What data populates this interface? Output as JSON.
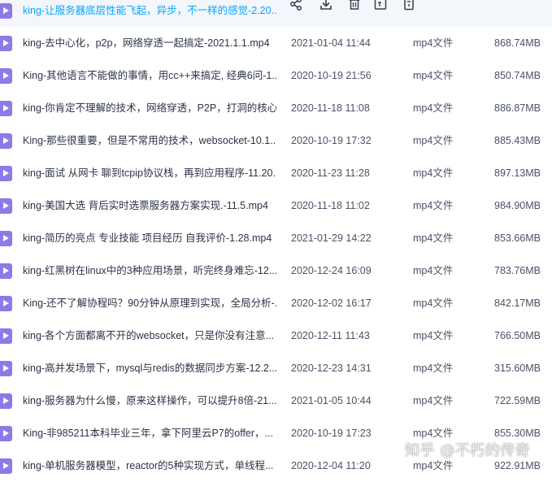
{
  "files": [
    {
      "name": "king-让服务器底层性能飞起，异步，不一样的感觉-2.20...",
      "date": "",
      "type": "",
      "size": "",
      "hovered": true
    },
    {
      "name": "king-去中心化，p2p，网络穿透一起搞定-2021.1.1.mp4",
      "date": "2021-01-04 11:44",
      "type": "mp4文件",
      "size": "868.74MB"
    },
    {
      "name": "King-其他语言不能做的事情，用cc++来搞定, 经典6问-1...",
      "date": "2020-10-19 21:56",
      "type": "mp4文件",
      "size": "850.74MB"
    },
    {
      "name": "king-你肯定不理解的技术，网络穿透，P2P，打洞的核心...",
      "date": "2020-11-18 11:08",
      "type": "mp4文件",
      "size": "886.87MB"
    },
    {
      "name": "King-那些很重要，但是不常用的技术，websocket-10.1...",
      "date": "2020-10-19 17:32",
      "type": "mp4文件",
      "size": "885.43MB"
    },
    {
      "name": "king-面试 从网卡 聊到tcpip协议栈，再到应用程序-11.20...",
      "date": "2020-11-23 11:28",
      "type": "mp4文件",
      "size": "897.13MB"
    },
    {
      "name": "king-美国大选 背后实时选票服务器方案实现.-11.5.mp4",
      "date": "2020-11-18 11:02",
      "type": "mp4文件",
      "size": "984.90MB"
    },
    {
      "name": "king-简历的亮点 专业技能 项目经历 自我评价-1.28.mp4",
      "date": "2021-01-29 14:22",
      "type": "mp4文件",
      "size": "853.66MB"
    },
    {
      "name": "king-红黑树在linux中的3种应用场景，听完终身难忘-12....",
      "date": "2020-12-24 16:09",
      "type": "mp4文件",
      "size": "783.76MB"
    },
    {
      "name": "King-还不了解协程吗？90分钟从原理到实现，全局分析-...",
      "date": "2020-12-02 16:17",
      "type": "mp4文件",
      "size": "842.17MB"
    },
    {
      "name": "king-各个方面都离不开的websocket，只是你没有注意...",
      "date": "2020-12-11 11:43",
      "type": "mp4文件",
      "size": "766.50MB"
    },
    {
      "name": "king-高并发场景下，mysql与redis的数据同步方案-12.2...",
      "date": "2020-12-23 14:31",
      "type": "mp4文件",
      "size": "315.60MB"
    },
    {
      "name": "king-服务器为什么慢，原来这样操作，可以提升8倍-21....",
      "date": "2021-01-05 10:44",
      "type": "mp4文件",
      "size": "722.59MB"
    },
    {
      "name": "King-非985211本科毕业三年，拿下阿里云P7的offer，...",
      "date": "2020-10-19 17:23",
      "type": "mp4文件",
      "size": "855.30MB"
    },
    {
      "name": "king-单机服务器模型，reactor的5种实现方式，单线程...",
      "date": "2020-12-04 11:20",
      "type": "mp4文件",
      "size": "922.91MB"
    }
  ],
  "row_actions": [
    {
      "icon": "share-icon"
    },
    {
      "icon": "download-icon"
    },
    {
      "icon": "delete-icon"
    },
    {
      "icon": "rename-icon"
    },
    {
      "icon": "more-icon"
    }
  ],
  "watermark": "知乎 @不朽的传奇",
  "colors": {
    "file_icon": "#8c7ae8",
    "hover_text": "#06a7ff",
    "hover_bg": "#f3f6fb"
  }
}
